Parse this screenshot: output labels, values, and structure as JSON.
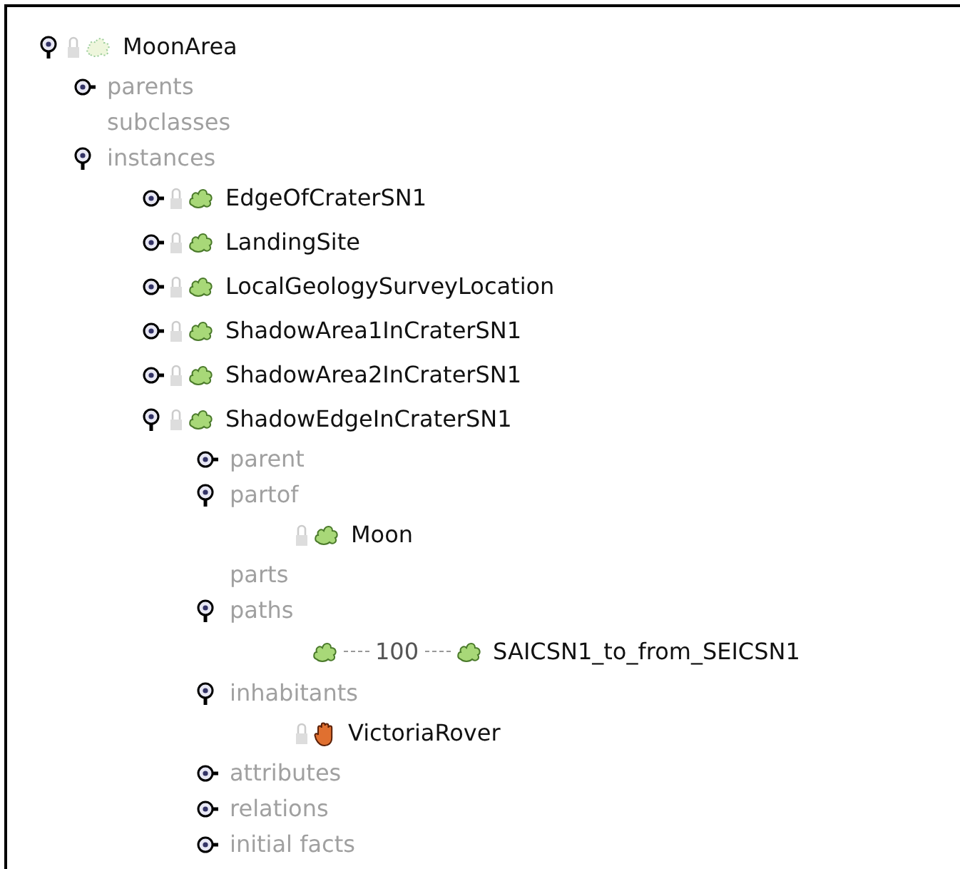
{
  "tree": [
    {
      "kind": "class",
      "label": "MoonArea",
      "expanded": true,
      "children": [
        {
          "kind": "slot",
          "label": "parents",
          "expanded": false
        },
        {
          "kind": "slot",
          "label": "subclasses"
        },
        {
          "kind": "slot",
          "label": "instances",
          "expanded": true,
          "children": [
            {
              "kind": "area",
              "label": "EdgeOfCraterSN1",
              "expanded": false
            },
            {
              "kind": "area",
              "label": "LandingSite",
              "expanded": false
            },
            {
              "kind": "area",
              "label": "LocalGeologySurveyLocation",
              "expanded": false
            },
            {
              "kind": "area",
              "label": "ShadowArea1InCraterSN1",
              "expanded": false
            },
            {
              "kind": "area",
              "label": "ShadowArea2InCraterSN1",
              "expanded": false
            },
            {
              "kind": "area",
              "label": "ShadowEdgeInCraterSN1",
              "expanded": true,
              "children": [
                {
                  "kind": "slot",
                  "label": "parent",
                  "expanded": false
                },
                {
                  "kind": "slot",
                  "label": "partof",
                  "expanded": true,
                  "children": [
                    {
                      "kind": "area",
                      "label": "Moon"
                    }
                  ]
                },
                {
                  "kind": "slot",
                  "label": "parts"
                },
                {
                  "kind": "slot",
                  "label": "paths",
                  "expanded": true,
                  "children": [
                    {
                      "kind": "path",
                      "weight": "100",
                      "label": "SAICSN1_to_from_SEICSN1"
                    }
                  ]
                },
                {
                  "kind": "slot",
                  "label": "inhabitants",
                  "expanded": true,
                  "children": [
                    {
                      "kind": "agent",
                      "label": "VictoriaRover"
                    }
                  ]
                },
                {
                  "kind": "slot",
                  "label": "attributes",
                  "expanded": false
                },
                {
                  "kind": "slot",
                  "label": "relations",
                  "expanded": false
                },
                {
                  "kind": "slot",
                  "label": "initial facts",
                  "expanded": false
                }
              ]
            }
          ]
        }
      ]
    }
  ]
}
